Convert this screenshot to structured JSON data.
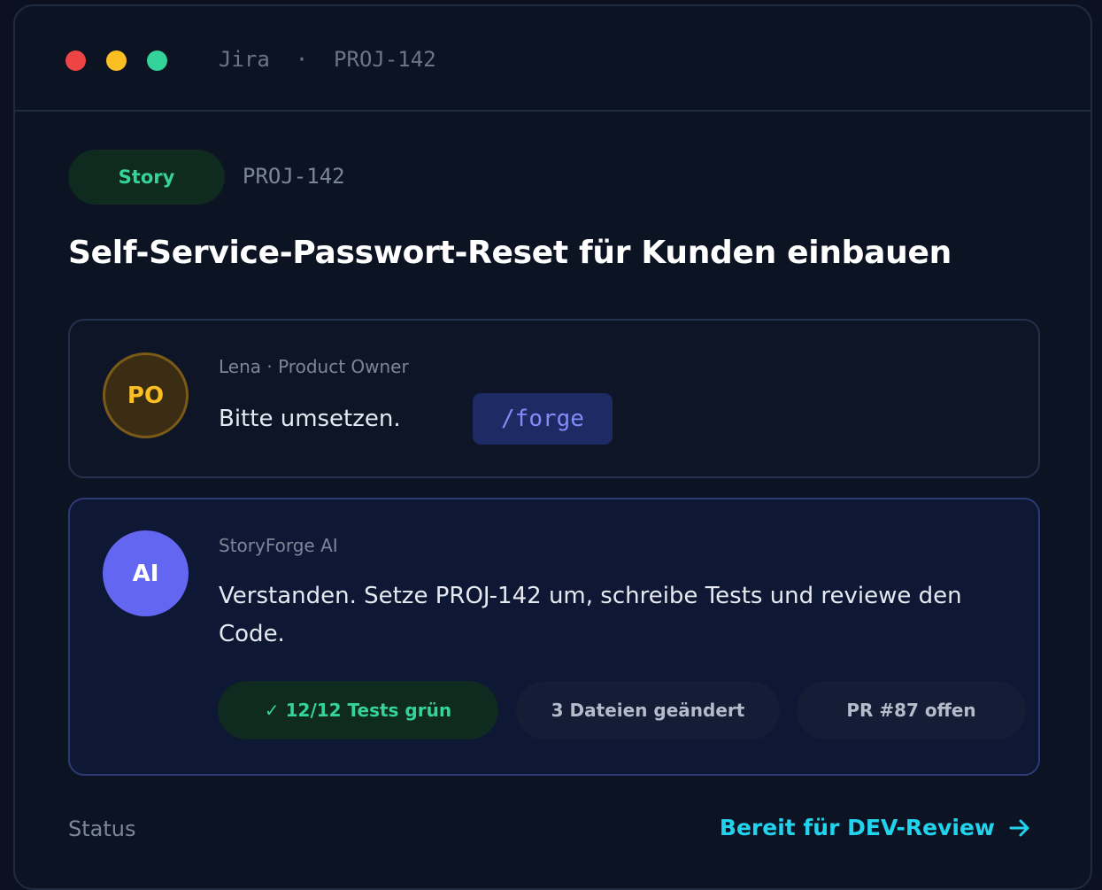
{
  "window": {
    "title": "Jira  ·  PROJ-142"
  },
  "issue": {
    "type": "Story",
    "key": "PROJ-142",
    "title": "Self-Service-Passwort-Reset für Kunden einbauen"
  },
  "comments": [
    {
      "avatar": "PO",
      "author": "Lena · Product Owner",
      "text": "Bitte umsetzen.",
      "command": "/forge"
    },
    {
      "avatar": "AI",
      "author": "StoryForge AI",
      "text": "Verstanden. Setze PROJ-142 um, schreibe Tests und reviewe den Code.",
      "pills": [
        "✓ 12/12 Tests grün",
        "3 Dateien geändert",
        "PR #87 offen"
      ]
    }
  ],
  "status": {
    "label": "Status",
    "value": "Bereit für DEV-Review",
    "icon": "arrow-right-icon"
  },
  "colors": {
    "background": "#0c1424",
    "accent_green": "#34d399",
    "accent_indigo": "#6366f1",
    "accent_amber": "#fbbf24",
    "accent_cyan": "#22d3ee",
    "dot_red": "#ef4444",
    "dot_yellow": "#fbbf24",
    "dot_green": "#34d399"
  }
}
